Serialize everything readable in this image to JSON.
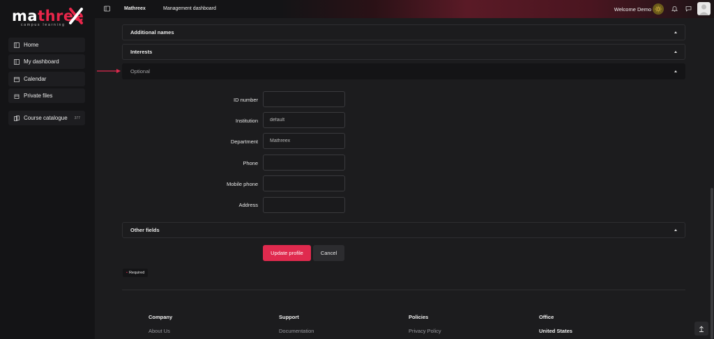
{
  "logo": {
    "main_pre": "ma",
    "main_hl": "three",
    "sub": "campus learning"
  },
  "sidebar": {
    "items": [
      {
        "label": "Home",
        "icon": "home-icon"
      },
      {
        "label": "My dashboard",
        "icon": "dashboard-icon"
      },
      {
        "label": "Calendar",
        "icon": "calendar-icon"
      },
      {
        "label": "Private files",
        "icon": "files-icon"
      }
    ],
    "catalogue": {
      "label": "Course catalogue",
      "count": "377",
      "icon": "catalogue-icon"
    }
  },
  "topbar": {
    "links": [
      "Mathreex",
      "Management dashboard"
    ],
    "welcome": "Welcome Demo"
  },
  "sections": {
    "additional_names": "Additional names",
    "interests": "Interests",
    "optional": "Optional",
    "other_fields": "Other fields"
  },
  "form": {
    "fields": [
      {
        "label": "ID number",
        "value": ""
      },
      {
        "label": "Institution",
        "value": "default"
      },
      {
        "label": "Department",
        "value": "Mathreex"
      },
      {
        "label": "Phone",
        "value": ""
      },
      {
        "label": "Mobile phone",
        "value": ""
      },
      {
        "label": "Address",
        "value": ""
      }
    ],
    "submit_label": "Update profile",
    "cancel_label": "Cancel",
    "required_note": "Required"
  },
  "footer": {
    "columns": [
      {
        "heading": "Company",
        "item": "About Us"
      },
      {
        "heading": "Support",
        "item": "Documentation"
      },
      {
        "heading": "Policies",
        "item": "Privacy Policy"
      },
      {
        "heading": "Office",
        "item": "United States"
      }
    ]
  },
  "colors": {
    "accent": "#e02a4e",
    "background": "#1c1c1e",
    "sidebar": "#141416"
  }
}
